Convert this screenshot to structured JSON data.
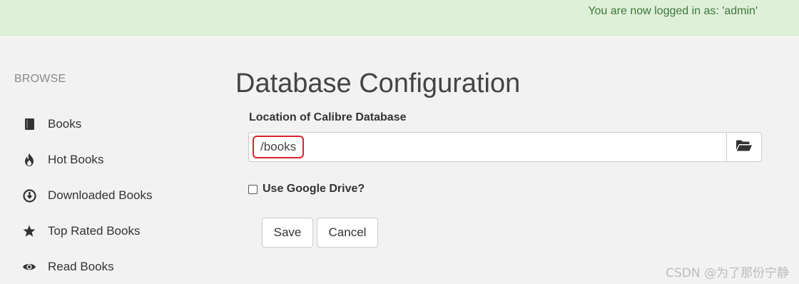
{
  "alert": {
    "message": "You are now logged in as: 'admin'",
    "background_color": "#dff0d8",
    "text_color": "#3c763d"
  },
  "sidebar": {
    "heading": "BROWSE",
    "items": [
      {
        "label": "Books",
        "icon": "book-icon"
      },
      {
        "label": "Hot Books",
        "icon": "fire-icon"
      },
      {
        "label": "Downloaded Books",
        "icon": "download-circle-icon"
      },
      {
        "label": "Top Rated Books",
        "icon": "star-icon"
      },
      {
        "label": "Read Books",
        "icon": "eye-icon"
      }
    ]
  },
  "main": {
    "title": "Database Configuration",
    "location_label": "Location of Calibre Database",
    "location_value": "/books",
    "folder_button_icon": "folder-open-icon",
    "google_drive_label": "Use Google Drive?",
    "google_drive_checked": false,
    "save_label": "Save",
    "cancel_label": "Cancel",
    "highlight_color": "#d9232d"
  },
  "watermark": {
    "text": "CSDN @为了那份宁静"
  }
}
